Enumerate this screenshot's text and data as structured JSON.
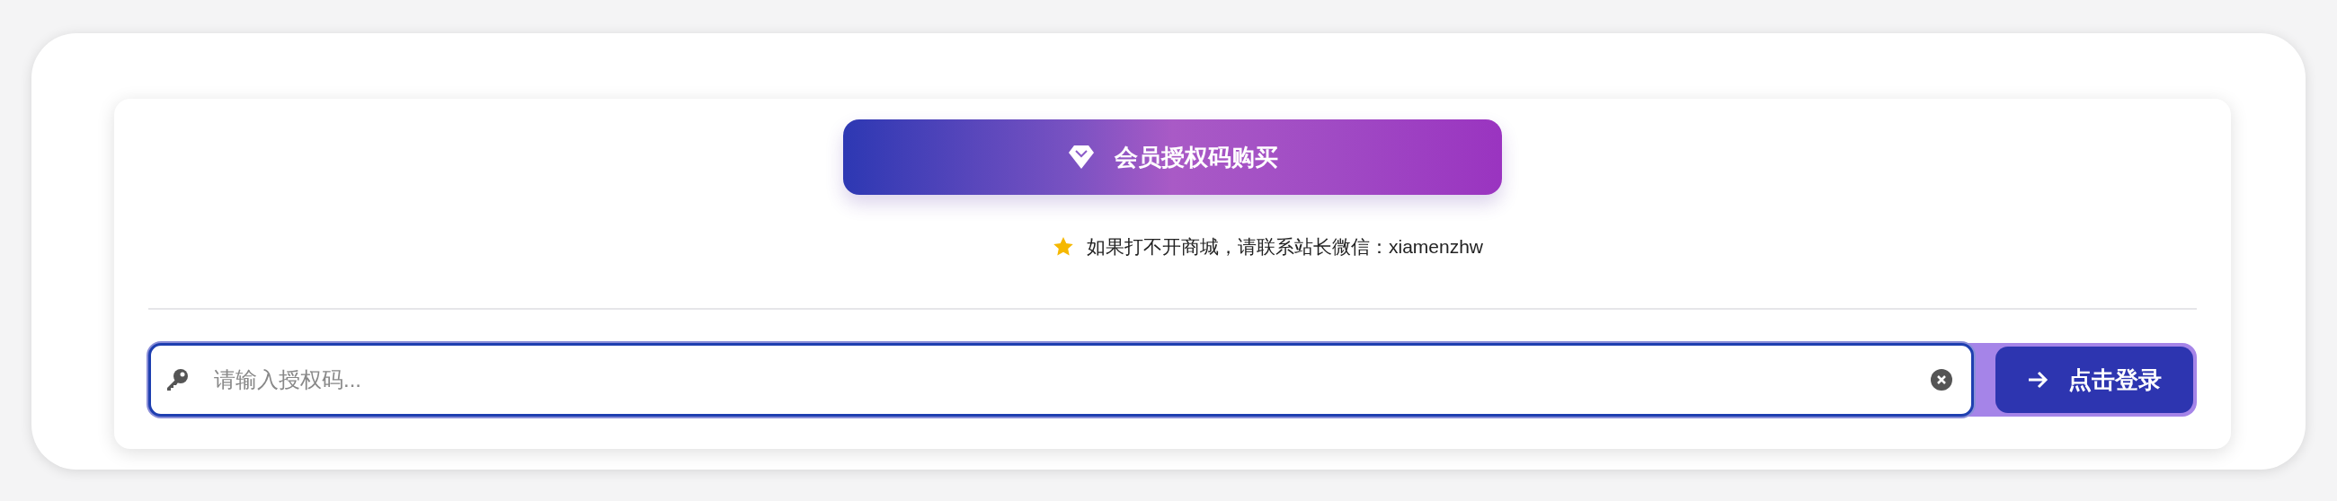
{
  "buy_button": {
    "label": "会员授权码购买"
  },
  "notice": {
    "text": "如果打不开商城，请联系站长微信：xiamenzhw"
  },
  "login": {
    "placeholder": "请输入授权码...",
    "button": "点击登录"
  }
}
